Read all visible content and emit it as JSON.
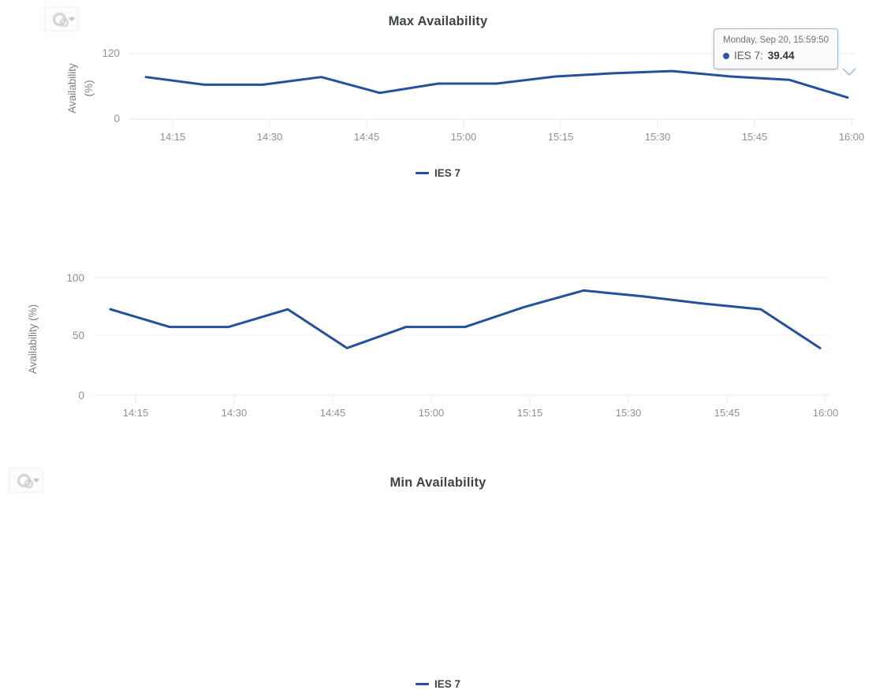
{
  "panels": [
    {
      "id": "max",
      "title": "Max Availability",
      "settings_icon": "cogs-icon",
      "caret_icon": "chevron-down-icon",
      "legend": {
        "label": "IES 7",
        "color": "#24519c"
      }
    },
    {
      "id": "min",
      "title": "Min Availability",
      "settings_icon": "cogs-icon",
      "caret_icon": "chevron-down-icon",
      "legend": {
        "label": "IES 7",
        "color": "#24519c"
      }
    }
  ],
  "tooltip": {
    "timestamp": "Monday, Sep 20, 15:59:50",
    "series_label": "IES 7:",
    "value": "39.44",
    "marker_color": "#2b57a6"
  },
  "chart_data": [
    {
      "type": "line",
      "title": "Max Availability",
      "xlabel": "",
      "ylabel": "Availability (%)",
      "ylabel_lines": [
        "Availability",
        "(%)"
      ],
      "ylim": [
        0,
        120
      ],
      "yticks": [
        0,
        120
      ],
      "ytick_labels": [
        "0",
        "120"
      ],
      "grid": true,
      "legend_position": "bottom",
      "xlim": [
        "14:05",
        "16:00"
      ],
      "xtick_labels": [
        "14:15",
        "14:30",
        "14:45",
        "15:00",
        "15:15",
        "15:30",
        "15:45",
        "16:00"
      ],
      "series": [
        {
          "name": "IES 7",
          "color": "#24519c",
          "x": [
            "14:05",
            "14:20",
            "14:30",
            "14:40",
            "14:50",
            "15:00",
            "15:10",
            "15:20",
            "15:30",
            "15:35",
            "15:45",
            "15:50",
            "16:00"
          ],
          "values": [
            77,
            63,
            63,
            77,
            48,
            65,
            65,
            78,
            84,
            88,
            78,
            72,
            39.44
          ]
        }
      ],
      "annotations": [
        {
          "kind": "tooltip",
          "x": "16:00",
          "y": 39.44,
          "timestamp": "Monday, Sep 20, 15:59:50",
          "series": "IES 7",
          "value": 39.44
        }
      ]
    },
    {
      "type": "line",
      "title": "Min Availability",
      "xlabel": "",
      "ylabel": "Availability (%)",
      "ylabel_lines": [
        "Availability (%)"
      ],
      "ylim": [
        0,
        100
      ],
      "yticks": [
        0,
        50,
        100
      ],
      "ytick_labels": [
        "0",
        "50",
        "100"
      ],
      "grid": true,
      "legend_position": "bottom",
      "xlim": [
        "14:05",
        "16:00"
      ],
      "xtick_labels": [
        "14:15",
        "14:30",
        "14:45",
        "15:00",
        "15:15",
        "15:30",
        "15:45",
        "16:00"
      ],
      "series": [
        {
          "name": "IES 7",
          "color": "#24519c",
          "x": [
            "14:05",
            "14:20",
            "14:30",
            "14:40",
            "14:50",
            "15:00",
            "15:10",
            "15:20",
            "15:30",
            "15:35",
            "15:45",
            "15:50",
            "16:00"
          ],
          "values": [
            73,
            58,
            58,
            73,
            40,
            58,
            58,
            75,
            89,
            84,
            78,
            73,
            40
          ]
        }
      ],
      "annotations": []
    }
  ]
}
